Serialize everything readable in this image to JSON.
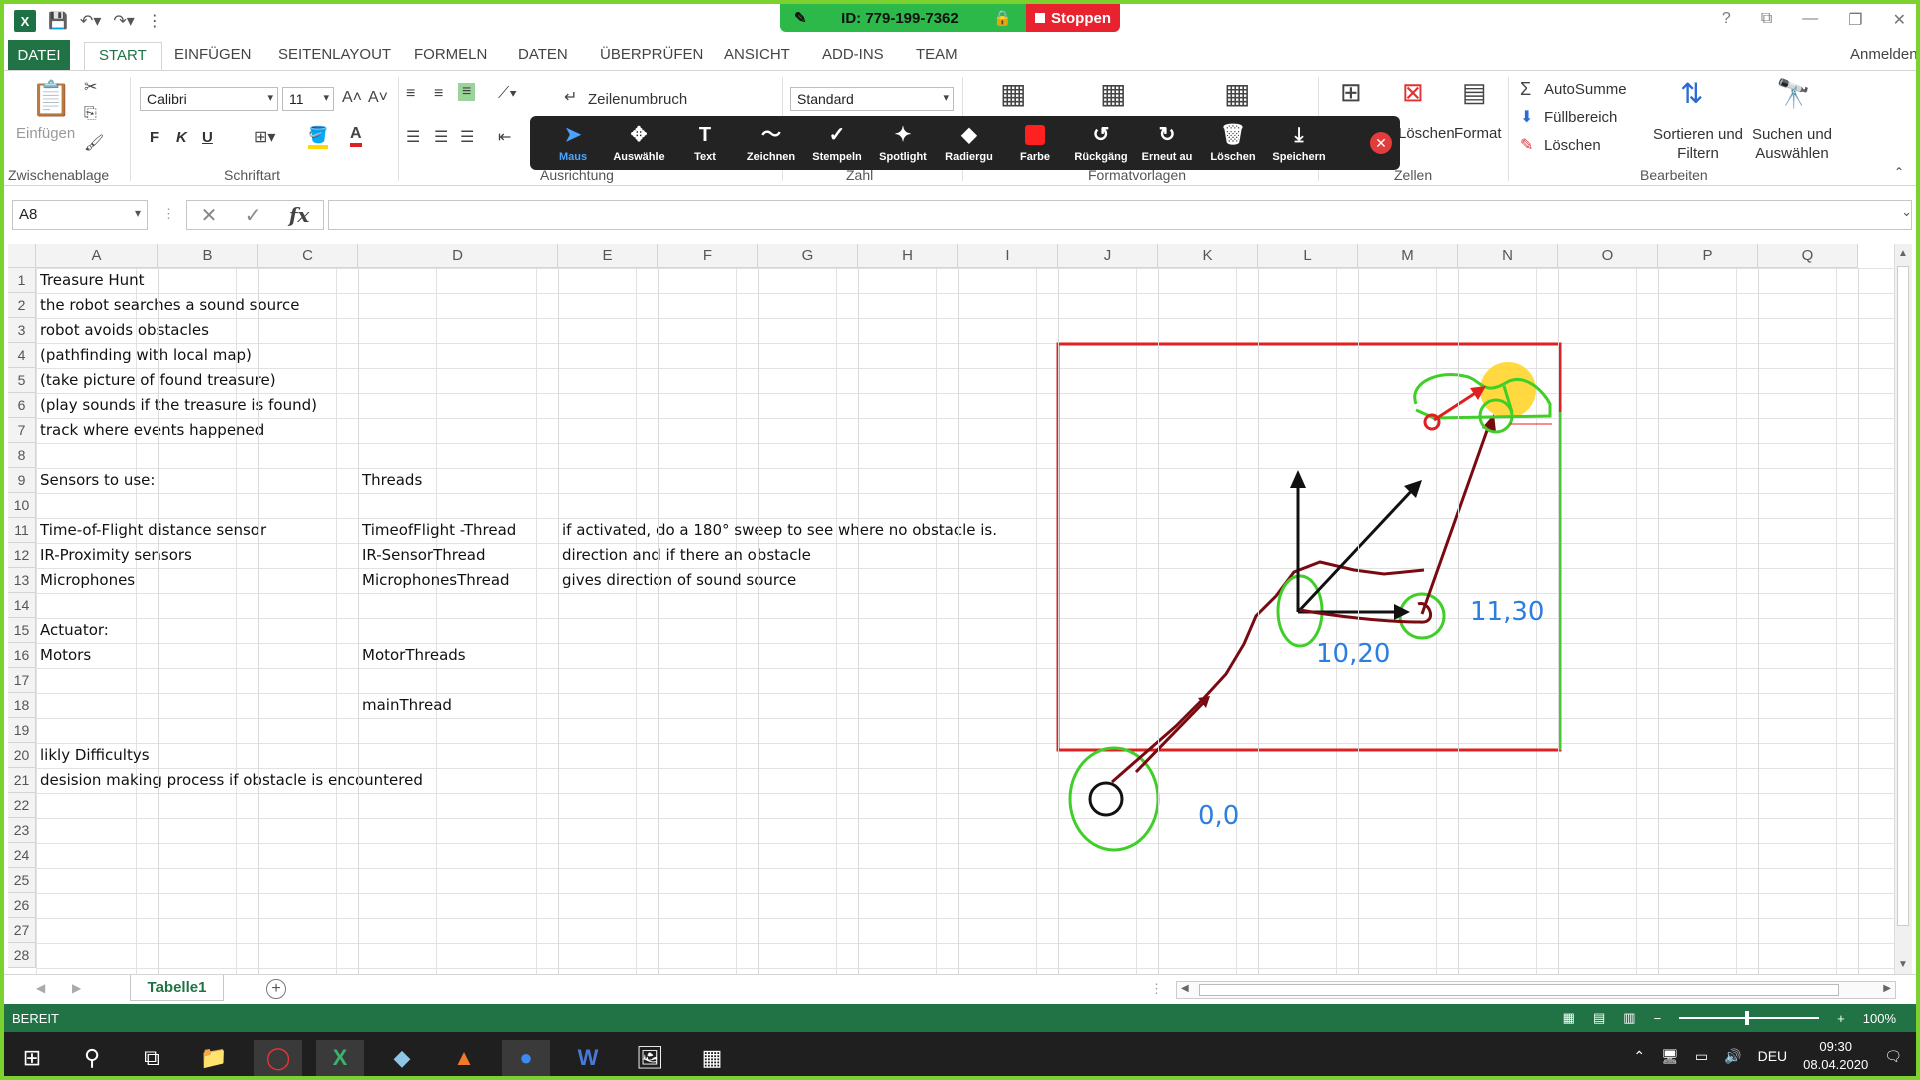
{
  "window": {
    "minimize": "—",
    "maximize": "❐",
    "close": "✕",
    "help": "?",
    "user": "Anmelden"
  },
  "zoom_share": {
    "id_text": "ID: 779-199-7362",
    "stop_label": "Stoppen"
  },
  "ribbon_tabs": [
    "DATEI",
    "START",
    "EINFÜGEN",
    "SEITENLAYOUT",
    "FORMELN",
    "DATEN",
    "ÜBERPRÜFEN",
    "ANSICHT",
    "ADD-INS",
    "TEAM"
  ],
  "ribbon": {
    "paste_label": "Einfügen",
    "clipboard_group": "Zwischenablage",
    "font_name": "Calibri",
    "font_size": "11",
    "font_group": "Schriftart",
    "wrap_text": "Zeilenumbruch",
    "alignment_group": "Ausrichtung",
    "number_format": "Standard",
    "number_group": "Zahl",
    "styles_group": "Formatvorlagen",
    "delete_label": "Löschen",
    "format_label": "Format",
    "cells_group": "Zellen",
    "autosum": "AutoSumme",
    "fill": "Füllbereich",
    "clear": "Löschen",
    "sort_filter": "Sortieren und Filtern",
    "find_select": "Suchen und Auswählen",
    "editing_group": "Bearbeiten",
    "bold": "F",
    "italic": "K",
    "underline": "U"
  },
  "annotation_toolbar": [
    {
      "label": "Maus",
      "icon": "mouse-pointer-icon",
      "selected": true
    },
    {
      "label": "Auswähle",
      "icon": "move-icon",
      "selected": false
    },
    {
      "label": "Text",
      "icon": "text-icon",
      "selected": false
    },
    {
      "label": "Zeichnen",
      "icon": "draw-icon",
      "selected": false
    },
    {
      "label": "Stempeln",
      "icon": "stamp-icon",
      "selected": false
    },
    {
      "label": "Spotlight",
      "icon": "spotlight-icon",
      "selected": false
    },
    {
      "label": "Radiergu",
      "icon": "eraser-icon",
      "selected": false
    },
    {
      "label": "Farbe",
      "icon": "color-icon",
      "selected": false
    },
    {
      "label": "Rückgäng",
      "icon": "undo-icon",
      "selected": false
    },
    {
      "label": "Erneut au",
      "icon": "redo-icon",
      "selected": false
    },
    {
      "label": "Löschen",
      "icon": "trash-icon",
      "selected": false
    },
    {
      "label": "Speichern",
      "icon": "save-icon",
      "selected": false
    }
  ],
  "formula_bar": {
    "name_box": "A8",
    "fx": "fx",
    "content": ""
  },
  "columns": [
    "A",
    "B",
    "C",
    "D",
    "E",
    "F",
    "G",
    "H",
    "I",
    "J",
    "K",
    "L",
    "M",
    "N",
    "O",
    "P",
    "Q"
  ],
  "rows": [
    "1",
    "2",
    "3",
    "4",
    "5",
    "6",
    "7",
    "8",
    "9",
    "10",
    "11",
    "12",
    "13",
    "14",
    "15",
    "16",
    "17",
    "18",
    "19",
    "20",
    "21",
    "22",
    "23",
    "24",
    "25",
    "26",
    "27",
    "28"
  ],
  "cells": [
    {
      "ref": "A1",
      "text": "Treasure Hunt"
    },
    {
      "ref": "A2",
      "text": "the robot searches a sound source"
    },
    {
      "ref": "A3",
      "text": "robot avoids obstacles"
    },
    {
      "ref": "A4",
      "text": "(pathfinding with local map)"
    },
    {
      "ref": "A5",
      "text": "(take picture of found treasure)"
    },
    {
      "ref": "A6",
      "text": "(play sounds if the treasure is found)"
    },
    {
      "ref": "A7",
      "text": "track where events happened"
    },
    {
      "ref": "A9",
      "text": "Sensors to use:"
    },
    {
      "ref": "D9",
      "text": "Threads"
    },
    {
      "ref": "A11",
      "text": "Time-of-Flight distance sensor"
    },
    {
      "ref": "D11",
      "text": "TimeofFlight -Thread"
    },
    {
      "ref": "E11",
      "text": "if activated, do a 180° sweep to see where no obstacle is."
    },
    {
      "ref": "A12",
      "text": "IR-Proximity sensors"
    },
    {
      "ref": "D12",
      "text": "IR-SensorThread"
    },
    {
      "ref": "E12",
      "text": "direction and if there an obstacle"
    },
    {
      "ref": "A13",
      "text": "Microphones"
    },
    {
      "ref": "D13",
      "text": "MicrophonesThread"
    },
    {
      "ref": "E13",
      "text": "gives direction of sound source"
    },
    {
      "ref": "A15",
      "text": "Actuator:"
    },
    {
      "ref": "A16",
      "text": "Motors"
    },
    {
      "ref": "D16",
      "text": "MotorThreads"
    },
    {
      "ref": "D18",
      "text": "mainThread"
    },
    {
      "ref": "A20",
      "text": "likly Difficultys"
    },
    {
      "ref": "A21",
      "text": "desision making process if obstacle is encountered"
    }
  ],
  "sketch_labels": {
    "origin": "0,0",
    "waypoint1": "10,20",
    "waypoint2": "11,30"
  },
  "sheet_tab": "Tabelle1",
  "status": {
    "ready": "BEREIT",
    "zoom": "100%"
  },
  "taskbar": {
    "language": "DEU",
    "time": "09:30",
    "date": "08.04.2020"
  },
  "colors": {
    "excel_green": "#217346",
    "zoom_green": "#2db84a",
    "stop_red": "#e8222f",
    "annotation_red": "#e02020",
    "annotation_green": "#3fcf28",
    "annotation_blue": "#2b7fe0",
    "annotation_darkred": "#7a0a12"
  }
}
